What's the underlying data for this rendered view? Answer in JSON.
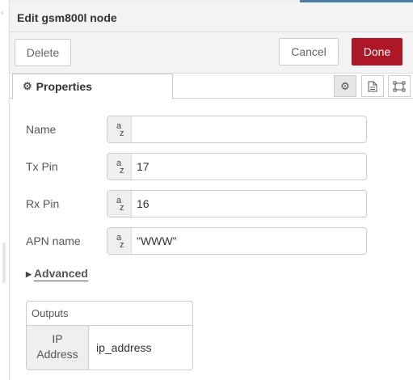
{
  "dialog": {
    "title": "Edit gsm800l node"
  },
  "buttons": {
    "delete": "Delete",
    "cancel": "Cancel",
    "done": "Done"
  },
  "tabs": {
    "properties": "Properties"
  },
  "tab_icons": [
    "gear-icon",
    "description-icon",
    "appearance-icon"
  ],
  "fields": [
    {
      "label": "Name",
      "value": ""
    },
    {
      "label": "Tx Pin",
      "value": "17"
    },
    {
      "label": "Rx Pin",
      "value": "16"
    },
    {
      "label": "APN name",
      "value": "\"WWW\""
    }
  ],
  "type_badge": {
    "a": "a",
    "z": "z"
  },
  "advanced": {
    "label": "Advanced"
  },
  "outputs": {
    "header": "Outputs",
    "rows": [
      {
        "key_line1": "IP",
        "key_line2": "Address",
        "value": "ip_address"
      }
    ]
  },
  "colors": {
    "done": "#ad1625",
    "accent": "#4a7fa3"
  }
}
